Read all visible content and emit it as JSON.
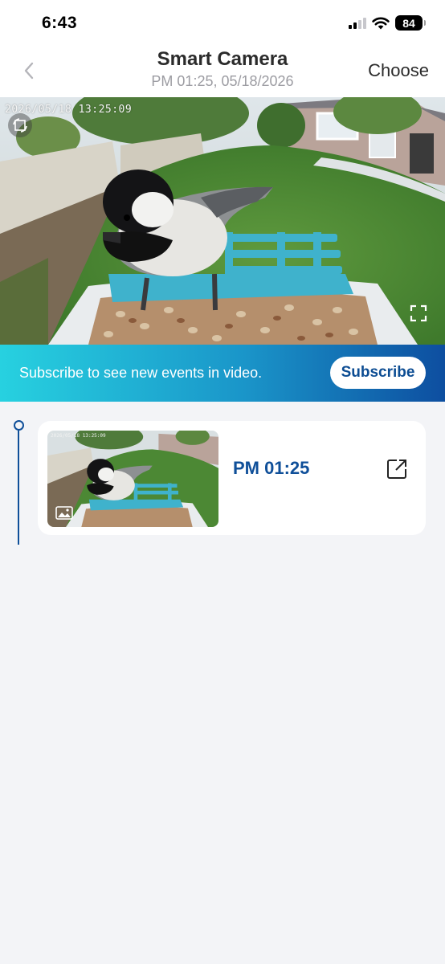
{
  "status_bar": {
    "time": "6:43",
    "battery": "84"
  },
  "header": {
    "title": "Smart Camera",
    "subtitle": "PM 01:25, 05/18/2026",
    "choose_label": "Choose",
    "back_icon": "chevron-left-icon"
  },
  "camera": {
    "timestamp": "2026/05/18  13:25:09",
    "rotate_icon": "rotate-icon",
    "fullscreen_icon": "fullscreen-icon"
  },
  "banner": {
    "text": "Subscribe to see new events in video.",
    "button_label": "Subscribe",
    "gradient": [
      "#27d1e0",
      "#0d4ea0"
    ]
  },
  "events": [
    {
      "time": "PM 01:25",
      "thumb_timestamp": "2026/05/18 13:25:09",
      "thumb_icon": "image-icon",
      "open_icon": "open-external-icon"
    }
  ],
  "colors": {
    "accent": "#0f4f99",
    "background": "#f3f4f7"
  }
}
